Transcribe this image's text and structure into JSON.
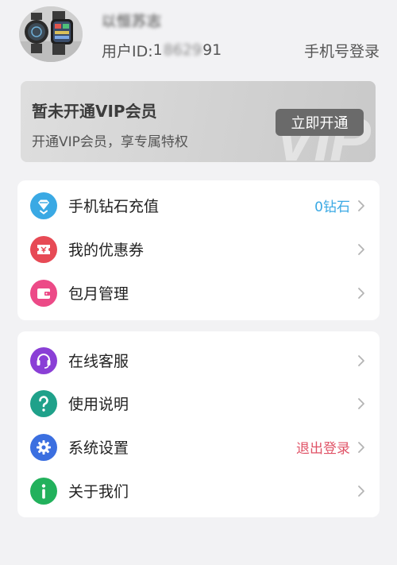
{
  "profile": {
    "nickname": "以恒苏志",
    "user_id_label": "用户ID:",
    "user_id_prefix": "1",
    "user_id_masked": "8629",
    "user_id_suffix": "91",
    "phone_login": "手机号登录",
    "avatar_icon": "smartwatch-photo-avatar"
  },
  "vip": {
    "title": "暂未开通VIP会员",
    "subtitle": "开通VIP会员，享专属特权",
    "button": "立即开通",
    "watermark": "VIP"
  },
  "menu_group_1": [
    {
      "label": "手机钻石充值",
      "value": "0钻石",
      "icon": "diamond-icon",
      "icon_color": "#3aa9e4",
      "value_color": "#3aa9e4"
    },
    {
      "label": "我的优惠券",
      "value": "",
      "icon": "coupon-icon",
      "icon_color": "#e74a55"
    },
    {
      "label": "包月管理",
      "value": "",
      "icon": "wallet-icon",
      "icon_color": "#ec4a87"
    }
  ],
  "menu_group_2": [
    {
      "label": "在线客服",
      "value": "",
      "icon": "headset-icon",
      "icon_color": "#8a3fd6"
    },
    {
      "label": "使用说明",
      "value": "",
      "icon": "question-icon",
      "icon_color": "#1fa18a"
    },
    {
      "label": "系统设置",
      "value": "退出登录",
      "icon": "gear-icon",
      "icon_color": "#3b6fe0",
      "value_color": "#e05367"
    },
    {
      "label": "关于我们",
      "value": "",
      "icon": "info-icon",
      "icon_color": "#22b15c"
    }
  ],
  "colors": {
    "background": "#f2f2f4",
    "card": "#ffffff",
    "vip_button": "#6a6a6a",
    "chevron": "#b4b4b4"
  }
}
